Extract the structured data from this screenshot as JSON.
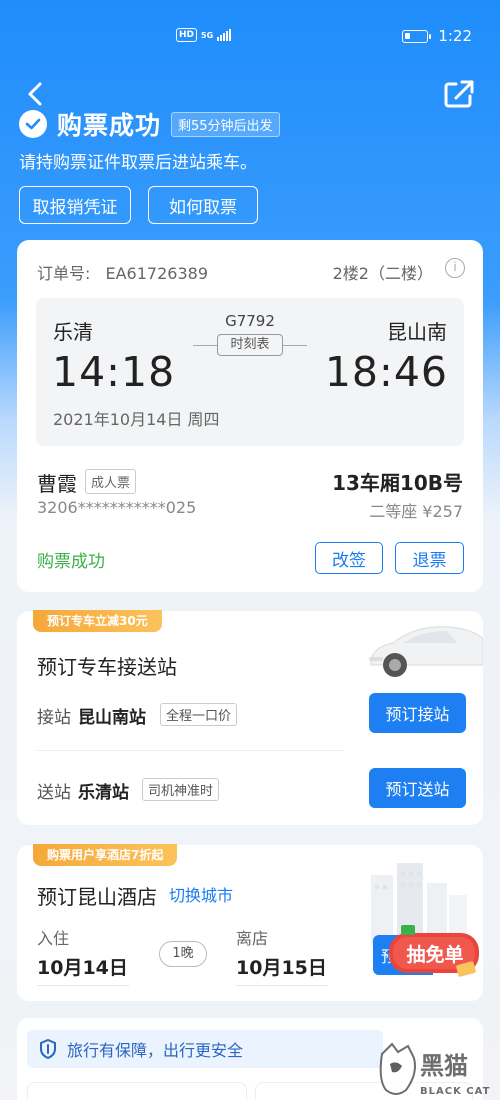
{
  "status_bar": {
    "hd": "HD",
    "network": "5G",
    "time": "1:22"
  },
  "header": {
    "title": "购票成功",
    "depart_badge": "剩55分钟后出发",
    "subtitle": "请持购票证件取票后进站乘车。",
    "receipt_button": "取报销凭证",
    "how_to_button": "如何取票"
  },
  "order": {
    "order_no_label": "订单号:",
    "order_no": "EA61726389",
    "floor": "2楼2（二楼）",
    "from_station": "乐清",
    "to_station": "昆山南",
    "train_no": "G7792",
    "timetable_label": "时刻表",
    "depart_time": "14:18",
    "arrive_time": "18:46",
    "date": "2021年10月14日 周四",
    "passenger_name": "曹霞",
    "ticket_type": "成人票",
    "seat": "13车厢10B号",
    "id_number": "3206***********025",
    "seat_class_price": "二等座 ¥257",
    "status": "购票成功",
    "change_button": "改签",
    "refund_button": "退票"
  },
  "car_service": {
    "promo_tag": "预订专车立减30元",
    "title": "预订专车接送站",
    "pickup_label": "接站",
    "pickup_station": "昆山南站",
    "pickup_tag": "全程一口价",
    "pickup_button": "预订接站",
    "dropoff_label": "送站",
    "dropoff_station": "乐清站",
    "dropoff_tag": "司机神准时",
    "dropoff_button": "预订送站"
  },
  "hotel": {
    "promo_tag": "购票用户享酒店7折起",
    "title": "预订昆山酒店",
    "switch_city": "切换城市",
    "checkin_label": "入住",
    "checkin_date": "10月14日",
    "nights": "1晚",
    "checkout_label": "离店",
    "checkout_date": "10月15日",
    "book_button": "预订",
    "free_badge": "抽免单"
  },
  "safety": {
    "banner": "旅行有保障，出行更安全"
  },
  "watermark": {
    "text_cn": "黑猫",
    "text_en": "BLACK CAT"
  },
  "colors": {
    "primary": "#1d7ff2",
    "success": "#3cb04a",
    "promo": "#f6a83a",
    "badge_red": "#e8453c"
  }
}
